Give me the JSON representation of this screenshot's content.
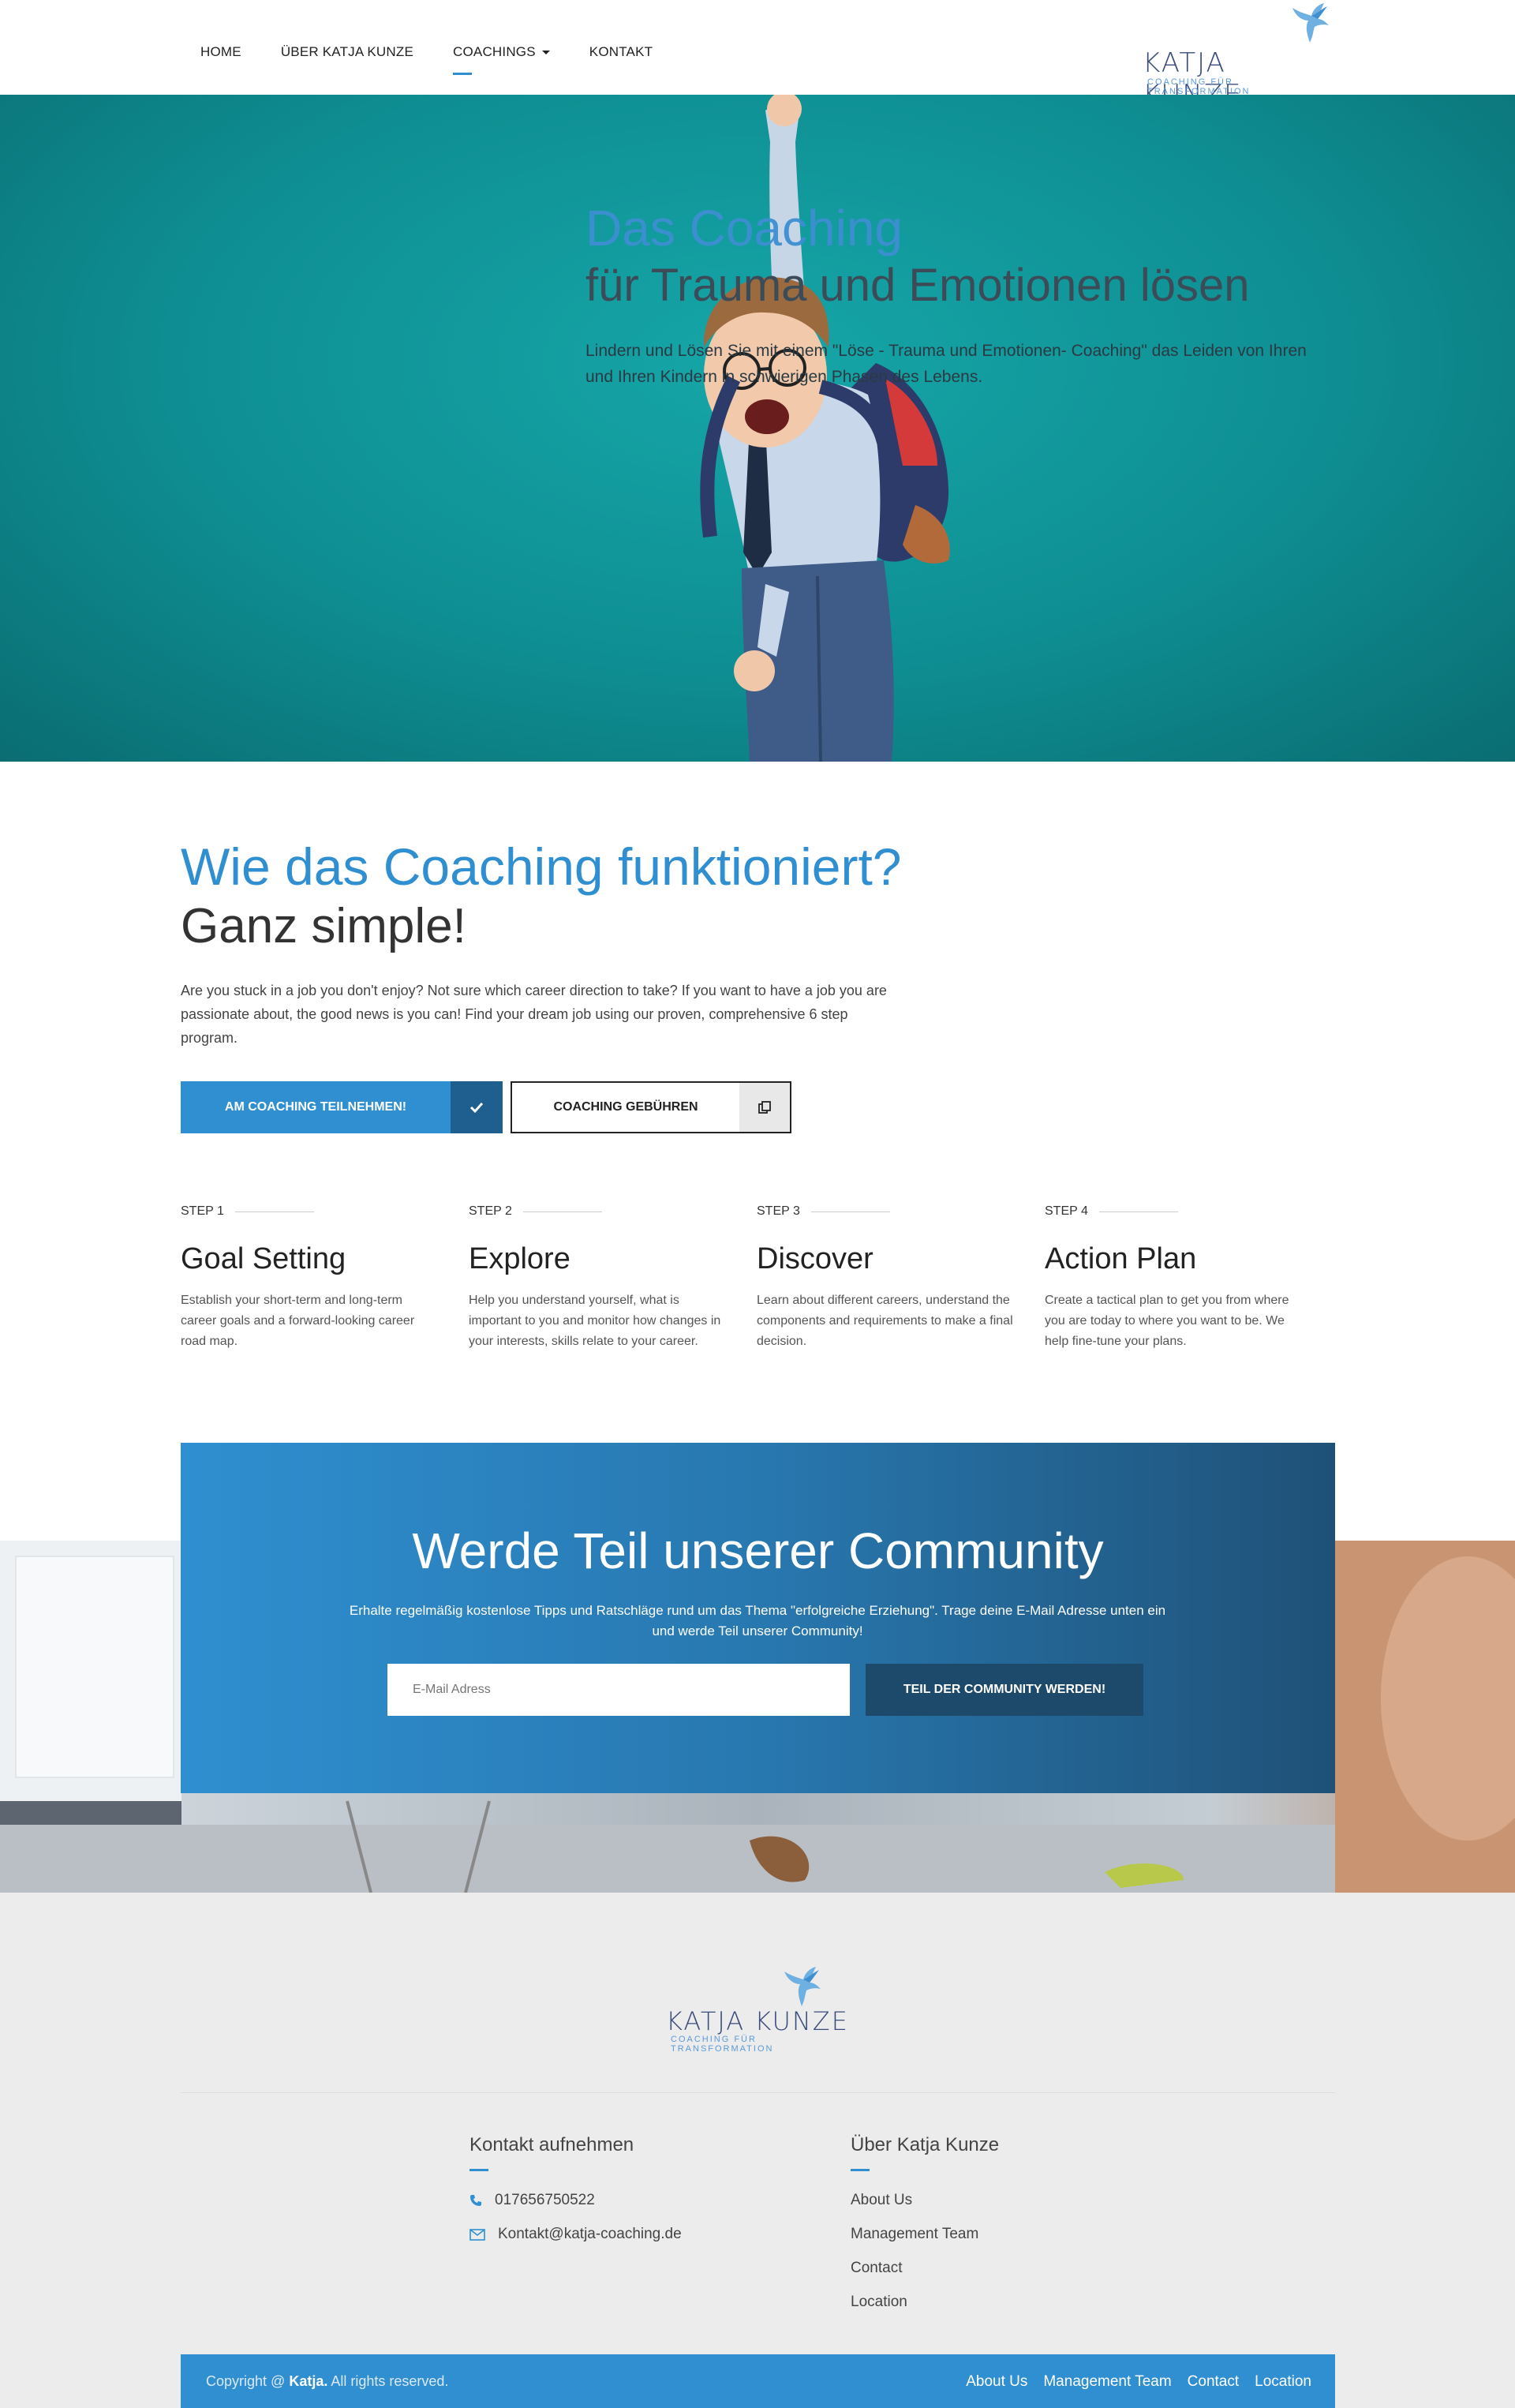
{
  "nav": {
    "items": [
      {
        "label": "HOME"
      },
      {
        "label": "ÜBER KATJA KUNZE"
      },
      {
        "label": "COACHINGS"
      },
      {
        "label": "KONTAKT"
      }
    ]
  },
  "logo": {
    "name": "KATJA KUNZE",
    "tagline": "COACHING FÜR TRANSFORMATION"
  },
  "hero": {
    "title_line1": "Das Coaching",
    "title_line2": "für Trauma und Emotionen lösen",
    "text": "Lindern und Lösen Sie mit einem \"Löse - Trauma und Emotionen- Coaching\" das Leiden von Ihren und Ihren Kindern in schwierigen Phasen des Lebens."
  },
  "how": {
    "title_line1": "Wie das Coaching funktioniert?",
    "title_line2": "Ganz simple!",
    "text": "Are you stuck in a job you don't enjoy? Not sure which career direction to take? If you want to have a job you are passionate about, the good news is you can! Find your dream job using our proven, comprehensive 6 step program.",
    "primary_button": "AM COACHING TEILNEHMEN!",
    "secondary_button": "COACHING GEBÜHREN"
  },
  "steps": [
    {
      "num": "STEP 1",
      "title": "Goal Setting",
      "text": "Establish your short-term and long-term career goals and a forward-looking career road map."
    },
    {
      "num": "STEP 2",
      "title": "Explore",
      "text": "Help you understand yourself, what is important to you and monitor how changes in your interests, skills relate to your career."
    },
    {
      "num": "STEP 3",
      "title": "Discover",
      "text": "Learn about different careers, understand the components and requirements to make a final decision."
    },
    {
      "num": "STEP 4",
      "title": "Action Plan",
      "text": "Create a tactical plan to get you from where you are today to where you want to be. We help fine-tune your plans."
    }
  ],
  "community": {
    "title": "Werde Teil unserer Community",
    "text": "Erhalte regelmäßig kostenlose Tipps und Ratschläge rund um das Thema \"erfolgreiche Erziehung\". Trage deine E-Mail Adresse unten ein und werde Teil unserer Community!",
    "input_placeholder": "E-Mail Adress",
    "button": "TEIL DER COMMUNITY WERDEN!"
  },
  "footer": {
    "contact_title": "Kontakt aufnehmen",
    "phone": "017656750522",
    "email": "Kontakt@katja-coaching.de",
    "about_title": "Über Katja Kunze",
    "about_links": [
      "About Us",
      "Management Team",
      "Contact",
      "Location"
    ],
    "copyright_prefix": "Copyright @",
    "copyright_name": "Katja.",
    "copyright_suffix": "All rights reserved.",
    "bottom_links": [
      "About Us",
      "Management Team",
      "Contact",
      "Location"
    ]
  },
  "colors": {
    "accent": "#2f8fd0",
    "dark_accent": "#1e5f8f",
    "hero_teal": "#0e8e92",
    "logo_navy": "#3a4c7d"
  }
}
